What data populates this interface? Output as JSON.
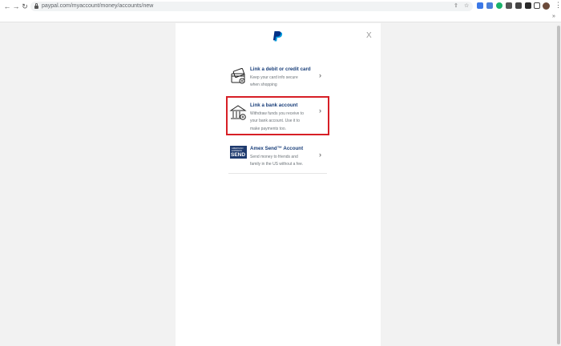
{
  "browser": {
    "url": "paypal.com/myaccount/money/accounts/new",
    "more_chevron": "»"
  },
  "icons": {
    "back": "arrow-left",
    "forward": "arrow-right",
    "reload": "reload",
    "close_modal": "close-x",
    "chevron": "chevron-right"
  },
  "modal": {
    "close_label": "X",
    "items": [
      {
        "title": "Link a debit or credit card",
        "description": "Keep your card info secure when shopping"
      },
      {
        "title": "Link a bank account",
        "description": "Withdraw funds you receive to your bank account. Use it to make payments too."
      },
      {
        "title": "Amex Send™ Account",
        "description": "Send money to friends and family in the US without a fee.",
        "logo_top": "AMERICAN EXPRESS",
        "logo_text": "SEND"
      }
    ],
    "chevron_glyph": "›"
  },
  "colors": {
    "link_title": "#1a3f7a",
    "highlight_border": "#d71f26",
    "paypal_dark": "#003087",
    "paypal_light": "#009cde"
  }
}
